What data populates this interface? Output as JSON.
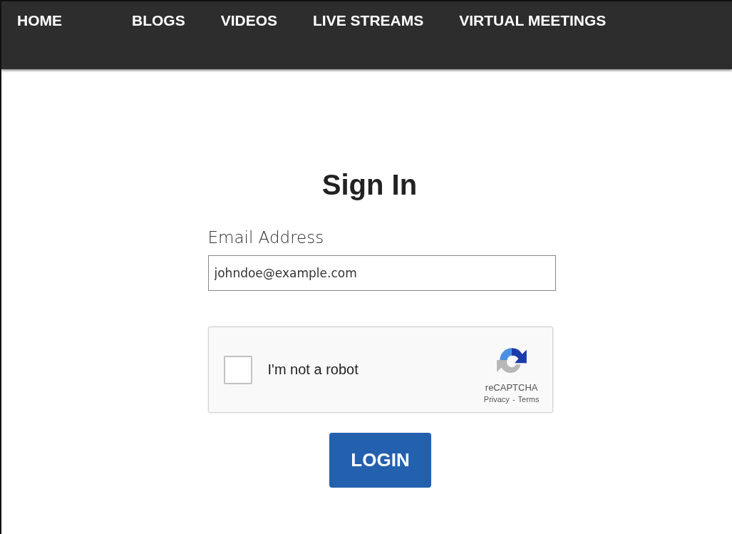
{
  "nav": {
    "items": [
      {
        "label": "HOME"
      },
      {
        "label": "BLOGS"
      },
      {
        "label": "VIDEOS"
      },
      {
        "label": "LIVE STREAMS"
      },
      {
        "label": "VIRTUAL MEETINGS"
      }
    ]
  },
  "form": {
    "title": "Sign In",
    "email_label": "Email Address",
    "email_value": "johndoe@example.com",
    "captcha": {
      "label": "I'm not a robot",
      "checked": false,
      "brand": "reCAPTCHA",
      "privacy": "Privacy",
      "separator": "-",
      "terms": "Terms"
    },
    "submit": "LOGIN"
  }
}
